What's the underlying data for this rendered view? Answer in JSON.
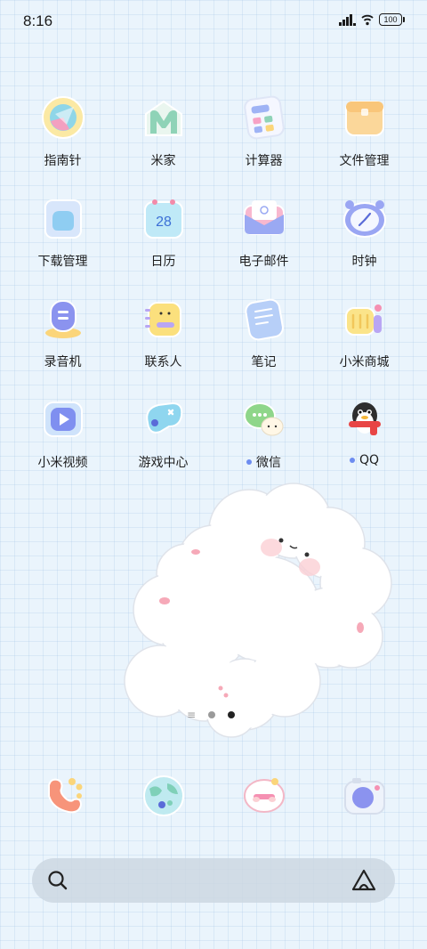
{
  "status_bar": {
    "time": "8:16",
    "battery": "100"
  },
  "apps": [
    {
      "label": "指南针",
      "icon": "compass-icon"
    },
    {
      "label": "米家",
      "icon": "mi-home-icon"
    },
    {
      "label": "计算器",
      "icon": "calculator-icon"
    },
    {
      "label": "文件管理",
      "icon": "file-manager-icon"
    },
    {
      "label": "下载管理",
      "icon": "download-manager-icon"
    },
    {
      "label": "日历",
      "icon": "calendar-icon",
      "badge": "28"
    },
    {
      "label": "电子邮件",
      "icon": "email-icon"
    },
    {
      "label": "时钟",
      "icon": "clock-icon"
    },
    {
      "label": "录音机",
      "icon": "recorder-icon"
    },
    {
      "label": "联系人",
      "icon": "contacts-icon"
    },
    {
      "label": "笔记",
      "icon": "notes-icon"
    },
    {
      "label": "小米商城",
      "icon": "mi-store-icon"
    },
    {
      "label": "小米视频",
      "icon": "mi-video-icon"
    },
    {
      "label": "游戏中心",
      "icon": "game-center-icon"
    },
    {
      "label": "微信",
      "icon": "wechat-icon",
      "new_dot": true
    },
    {
      "label": "QQ",
      "icon": "qq-icon",
      "new_dot": true
    }
  ],
  "dock": [
    {
      "icon": "phone-icon"
    },
    {
      "icon": "browser-icon"
    },
    {
      "icon": "messages-icon"
    },
    {
      "icon": "camera-icon"
    }
  ],
  "page_indicator": {
    "pages": 2,
    "active": 2
  },
  "colors": {
    "accent_dot": "#6d8cf0",
    "background": "#eaf4fc"
  }
}
